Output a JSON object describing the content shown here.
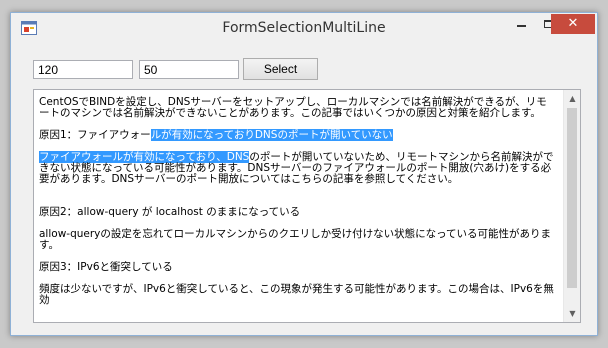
{
  "window": {
    "title": "FormSelectionMultiLine",
    "minimize_icon": "minimize-icon",
    "maximize_icon": "maximize-icon",
    "close_label": "✕"
  },
  "inputs": {
    "start_value": "120",
    "length_value": "50"
  },
  "select_button": {
    "label": "Select"
  },
  "memo": {
    "para1": "CentOSでBINDを設定し、DNSサーバーをセットアップし、ローカルマシンでは名前解決ができるが、リモートのマシンでは名前解決ができないことがあります。この記事ではいくつかの原因と対策を紹介します。",
    "para2_plain": "原因1：ファイアウォー",
    "para2_selected": "ルが有効になっておりDNSのポートが開いていない",
    "para3_selected": "ファイアウォールが有効になっており、DNS",
    "para3_plain": "のポートが開いていないため、リモートマシンから名前解決ができない状態になっている可能性があります。DNSサーバーのファイアウォールのポート開放(穴あけ)をする必要があります。DNSサーバーのポート開放についてはこちらの記事を参照してください。",
    "para4": "原因2：allow-query が localhost のままになっている",
    "para5": "allow-queryの設定を忘れてローカルマシンからのクエリしか受け付けない状態になっている可能性があります。",
    "para6": "原因3：IPv6と衝突している",
    "para7": "頻度は少ないですが、IPv6と衝突していると、この現象が発生する可能性があります。この場合は、IPv6を無効"
  },
  "scrollbar": {
    "up_arrow": "▲",
    "down_arrow": "▼"
  },
  "colors": {
    "selection": "#3399ff",
    "close_button": "#c74b3d",
    "window_border": "#8fb1d6"
  }
}
